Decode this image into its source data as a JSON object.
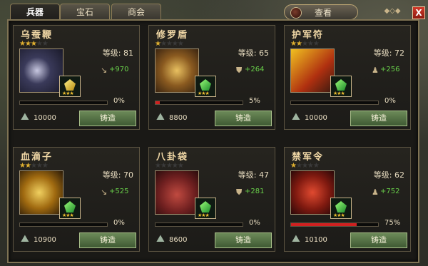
{
  "tabs": [
    "兵器",
    "宝石",
    "商会"
  ],
  "view_button": "查看",
  "close_button": "X",
  "colors": {
    "accent": "#c9b48a",
    "bonus": "#69d04a",
    "progress": "#d02020",
    "button": "#587a48"
  },
  "cards": [
    {
      "name": "乌蚕鞭",
      "stars": 3,
      "level_text": "等级: 81",
      "attr_icon": "sword-icon",
      "bonus": "+970",
      "progress": 0.0,
      "pct": "0%",
      "cost": "10000",
      "btn": "铸造",
      "gem": "gold"
    },
    {
      "name": "修罗盾",
      "stars": 1,
      "level_text": "等级: 65",
      "attr_icon": "shield-icon",
      "bonus": "+264",
      "progress": 0.05,
      "pct": "5%",
      "cost": "8800",
      "btn": "铸造",
      "gem": "green"
    },
    {
      "name": "护军符",
      "stars": 2,
      "level_text": "等级: 72",
      "attr_icon": "person-icon",
      "bonus": "+256",
      "progress": 0.0,
      "pct": "0%",
      "cost": "10000",
      "btn": "铸造",
      "gem": "green"
    },
    {
      "name": "血滴子",
      "stars": 2,
      "level_text": "等级: 70",
      "attr_icon": "sword-icon",
      "bonus": "+525",
      "progress": 0.0,
      "pct": "0%",
      "cost": "10900",
      "btn": "铸造",
      "gem": "green"
    },
    {
      "name": "八卦袋",
      "stars": 0,
      "level_text": "等级: 47",
      "attr_icon": "shield-icon",
      "bonus": "+281",
      "progress": 0.0,
      "pct": "0%",
      "cost": "8600",
      "btn": "铸造",
      "gem": "green"
    },
    {
      "name": "禁军令",
      "stars": 1,
      "level_text": "等级: 62",
      "attr_icon": "person-icon",
      "bonus": "+752",
      "progress": 0.75,
      "pct": "75%",
      "cost": "10100",
      "btn": "铸造",
      "gem": "green"
    }
  ]
}
